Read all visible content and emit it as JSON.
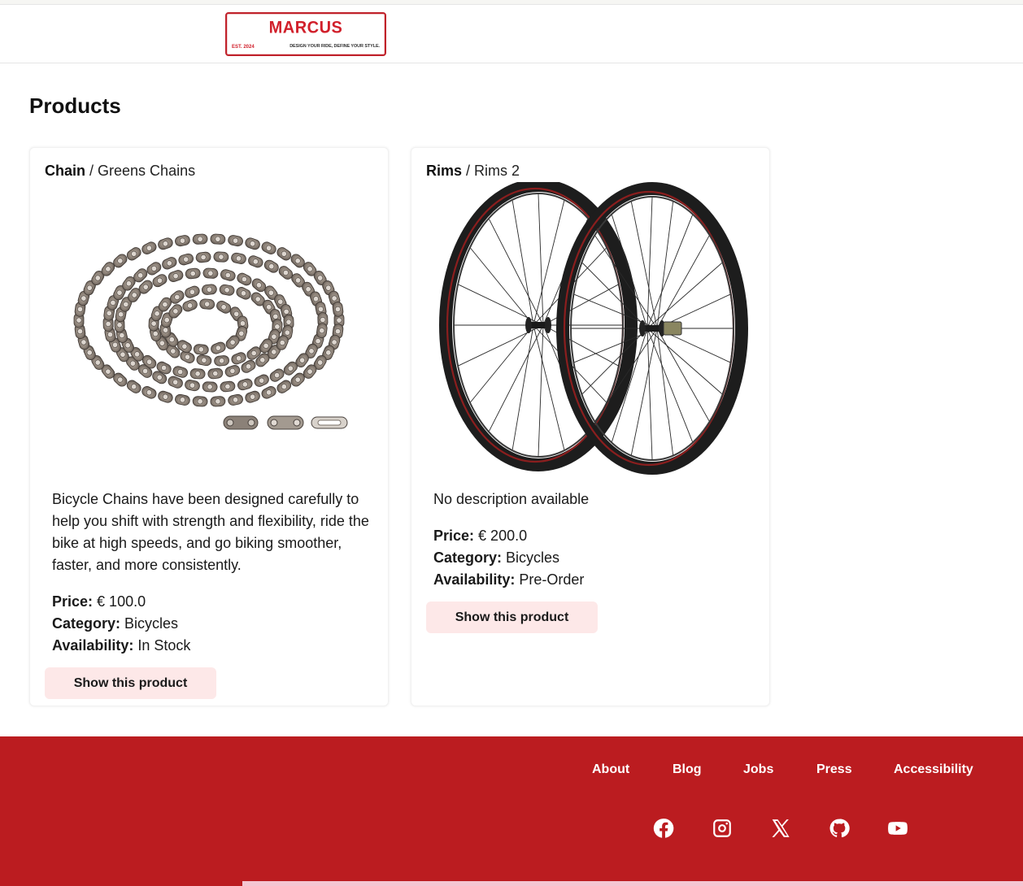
{
  "header": {
    "logo": {
      "name": "MARCUS",
      "est": "EST. 2024",
      "tagline": "DESIGN YOUR RIDE, DEFINE YOUR STYLE."
    }
  },
  "page": {
    "title": "Products"
  },
  "products": [
    {
      "category": "Chain",
      "name": "Greens Chains",
      "image_icon": "bicycle-chain-image",
      "description": "Bicycle Chains have been designed carefully to help you shift with strength and flexibility, ride the bike at high speeds, and go biking smoother, faster, and more consistently.",
      "price_label": "Price:",
      "price": "€ 100.0",
      "category_label": "Category:",
      "category_value": "Bicycles",
      "availability_label": "Availability:",
      "availability": "In Stock",
      "button": "Show this product"
    },
    {
      "category": "Rims",
      "name": "Rims 2",
      "image_icon": "bicycle-rims-image",
      "description": "No description available",
      "price_label": "Price:",
      "price": "€ 200.0",
      "category_label": "Category:",
      "category_value": "Bicycles",
      "availability_label": "Availability:",
      "availability": "Pre-Order",
      "button": "Show this product"
    }
  ],
  "footer": {
    "links": [
      "About",
      "Blog",
      "Jobs",
      "Press",
      "Accessibility"
    ],
    "social": [
      "facebook-icon",
      "instagram-icon",
      "x-icon",
      "github-icon",
      "youtube-icon"
    ],
    "background": "#bb1c20"
  },
  "colors": {
    "brand": "#d1202b",
    "button_bg": "#fde8e8"
  }
}
